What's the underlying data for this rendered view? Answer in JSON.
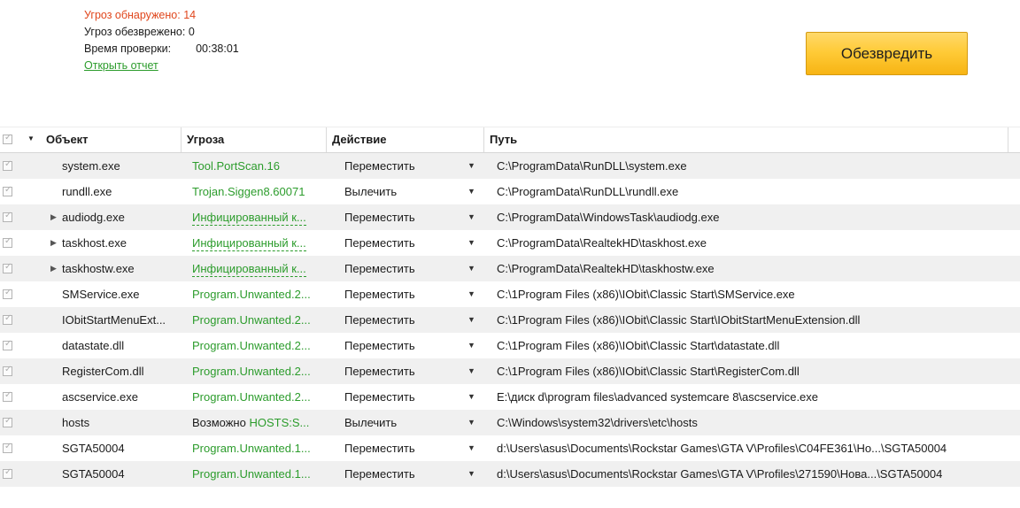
{
  "summary": {
    "detected_label": "Угроз обнаружено:",
    "detected_value": "14",
    "neutralized_label": "Угроз обезврежено:",
    "neutralized_value": "0",
    "time_label": "Время проверки:",
    "time_value": "00:38:01",
    "report_link": "Открыть отчет"
  },
  "neutralize_button": "Обезвредить",
  "colors": {
    "accent_orange": "#ffc72c",
    "threat_green": "#2c9c2c",
    "detected_red": "#e0461c"
  },
  "table": {
    "columns": {
      "object": "Объект",
      "threat": "Угроза",
      "action": "Действие",
      "path": "Путь"
    },
    "rows": [
      {
        "object": "system.exe",
        "expandable": false,
        "threat": "Tool.PortScan.16",
        "threat_prefix": "",
        "threat_dashed": false,
        "action": "Переместить",
        "path": "C:\\ProgramData\\RunDLL\\system.exe"
      },
      {
        "object": "rundll.exe",
        "expandable": false,
        "threat": "Trojan.Siggen8.60071",
        "threat_prefix": "",
        "threat_dashed": false,
        "action": "Вылечить",
        "path": "C:\\ProgramData\\RunDLL\\rundll.exe"
      },
      {
        "object": "audiodg.exe",
        "expandable": true,
        "threat": "Инфицированный к...",
        "threat_prefix": "",
        "threat_dashed": true,
        "action": "Переместить",
        "path": "C:\\ProgramData\\WindowsTask\\audiodg.exe"
      },
      {
        "object": "taskhost.exe",
        "expandable": true,
        "threat": "Инфицированный к...",
        "threat_prefix": "",
        "threat_dashed": true,
        "action": "Переместить",
        "path": "C:\\ProgramData\\RealtekHD\\taskhost.exe"
      },
      {
        "object": "taskhostw.exe",
        "expandable": true,
        "threat": "Инфицированный к...",
        "threat_prefix": "",
        "threat_dashed": true,
        "action": "Переместить",
        "path": "C:\\ProgramData\\RealtekHD\\taskhostw.exe"
      },
      {
        "object": "SMService.exe",
        "expandable": false,
        "threat": "Program.Unwanted.2...",
        "threat_prefix": "",
        "threat_dashed": false,
        "action": "Переместить",
        "path": "C:\\1Program Files (x86)\\IObit\\Classic Start\\SMService.exe"
      },
      {
        "object": "IObitStartMenuExt...",
        "expandable": false,
        "threat": "Program.Unwanted.2...",
        "threat_prefix": "",
        "threat_dashed": false,
        "action": "Переместить",
        "path": "C:\\1Program Files (x86)\\IObit\\Classic Start\\IObitStartMenuExtension.dll"
      },
      {
        "object": "datastate.dll",
        "expandable": false,
        "threat": "Program.Unwanted.2...",
        "threat_prefix": "",
        "threat_dashed": false,
        "action": "Переместить",
        "path": "C:\\1Program Files (x86)\\IObit\\Classic Start\\datastate.dll"
      },
      {
        "object": "RegisterCom.dll",
        "expandable": false,
        "threat": "Program.Unwanted.2...",
        "threat_prefix": "",
        "threat_dashed": false,
        "action": "Переместить",
        "path": "C:\\1Program Files (x86)\\IObit\\Classic Start\\RegisterCom.dll"
      },
      {
        "object": "ascservice.exe",
        "expandable": false,
        "threat": "Program.Unwanted.2...",
        "threat_prefix": "",
        "threat_dashed": false,
        "action": "Переместить",
        "path": "E:\\диск d\\program files\\advanced systemcare 8\\ascservice.exe"
      },
      {
        "object": "hosts",
        "expandable": false,
        "threat": "HOSTS:S...",
        "threat_prefix": "Возможно ",
        "threat_dashed": false,
        "action": "Вылечить",
        "path": "C:\\Windows\\system32\\drivers\\etc\\hosts"
      },
      {
        "object": "SGTA50004",
        "expandable": false,
        "threat": "Program.Unwanted.1...",
        "threat_prefix": "",
        "threat_dashed": false,
        "action": "Переместить",
        "path": "d:\\Users\\asus\\Documents\\Rockstar Games\\GTA V\\Profiles\\C04FE361\\Ho...\\SGTA50004"
      },
      {
        "object": "SGTA50004",
        "expandable": false,
        "threat": "Program.Unwanted.1...",
        "threat_prefix": "",
        "threat_dashed": false,
        "action": "Переместить",
        "path": "d:\\Users\\asus\\Documents\\Rockstar Games\\GTA V\\Profiles\\271590\\Нова...\\SGTA50004"
      }
    ]
  }
}
